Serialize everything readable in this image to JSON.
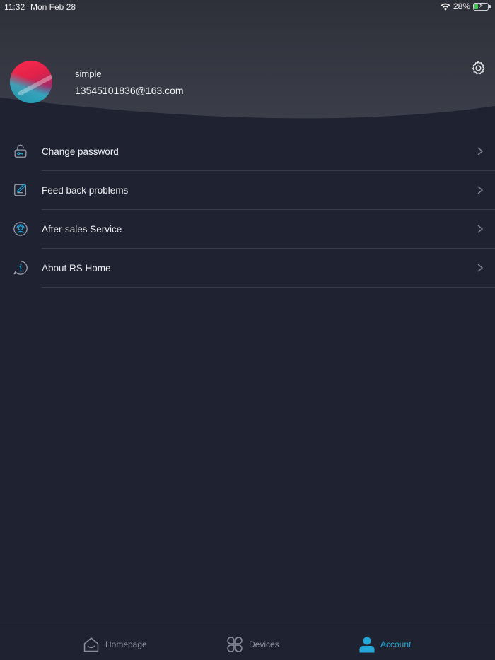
{
  "status_bar": {
    "time": "11:32",
    "date": "Mon Feb 28",
    "battery": "28%",
    "battery_level": 0.28
  },
  "profile": {
    "name": "simple",
    "email": "13545101836@163.com"
  },
  "menu": [
    {
      "label": "Change password",
      "icon": "unlock-icon"
    },
    {
      "label": "Feed back problems",
      "icon": "edit-note-icon"
    },
    {
      "label": "After-sales Service",
      "icon": "support-agent-icon"
    },
    {
      "label": "About RS Home",
      "icon": "info-icon"
    }
  ],
  "tabbar": {
    "home": "Homepage",
    "devices": "Devices",
    "account": "Account",
    "active": "Account"
  },
  "colors": {
    "background": "#1f2230",
    "header": "#3a3d48",
    "accent": "#22a8d8",
    "inactive": "#8c919e"
  }
}
